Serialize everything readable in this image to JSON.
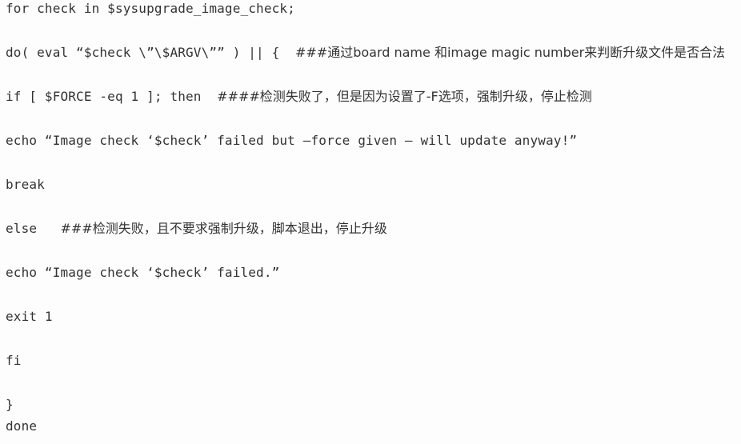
{
  "code": {
    "lines": [
      {
        "code": "for check in $sysupgrade_image_check;",
        "comment": ""
      },
      {
        "code": "do( eval “$check \\”\\$ARGV\\”” ) || {  ",
        "comment": "###通过board name 和image magic number来判断升级文件是否合法"
      },
      {
        "code": "if [ $FORCE -eq 1 ]; then  ",
        "comment": "####检测失败了，但是因为设置了-F选项，强制升级，停止检测"
      },
      {
        "code": "echo “Image check ‘$check’ failed but –force given – will update anyway!”",
        "comment": ""
      },
      {
        "code": "break",
        "comment": ""
      },
      {
        "code": "else   ",
        "comment": "###检测失败，且不要求强制升级，脚本退出，停止升级"
      },
      {
        "code": "echo “Image check ‘$check’ failed.”",
        "comment": ""
      },
      {
        "code": "exit 1",
        "comment": ""
      },
      {
        "code": "fi",
        "comment": ""
      },
      {
        "code": "}",
        "comment": ""
      },
      {
        "code": "done",
        "comment": ""
      }
    ]
  }
}
